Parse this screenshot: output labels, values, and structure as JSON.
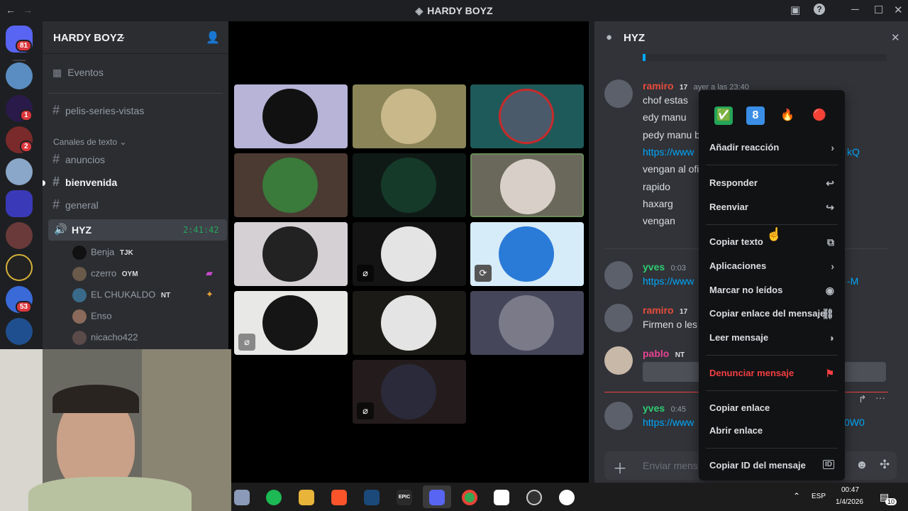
{
  "window": {
    "title": "HARDY BOYZ"
  },
  "rail": {
    "badges": [
      "81",
      "1",
      "2",
      "53"
    ]
  },
  "sidebar": {
    "server_name": "HARDY BOYZ",
    "events_label": "Eventos",
    "top_channel": "pelis-series-vistas",
    "category": "Canales de texto",
    "text_channels": [
      "anuncios",
      "bienvenida",
      "general"
    ],
    "voice_channel": "HYZ",
    "voice_timer": "2:41:42",
    "voice_users": [
      {
        "name": "Benja",
        "tag": "TJK"
      },
      {
        "name": "czerro",
        "tag": "OYM"
      },
      {
        "name": "EL CHUKALDO",
        "tag": "NT"
      },
      {
        "name": "Enso",
        "tag": ""
      },
      {
        "name": "nicacho422",
        "tag": ""
      }
    ]
  },
  "chat": {
    "channel": "HYZ",
    "messages": [
      {
        "user": "ramiro",
        "tag": "17",
        "time": "ayer a las 23:40",
        "lines": [
          "chof estas",
          "edy manu",
          "pedy manu b",
          "https://www",
          "vengan al ofi",
          "rapido",
          "haxarg",
          "vengan"
        ]
      },
      {
        "user": "yves",
        "time": "0:03",
        "lines": [
          "https://www"
        ]
      },
      {
        "user": "ramiro",
        "tag": "17",
        "lines": [
          "Firmen o les"
        ]
      },
      {
        "user": "pablo",
        "tag": "NT"
      },
      {
        "user": "yves",
        "time": "0:45",
        "lines": [
          "https://www"
        ]
      }
    ],
    "link_fragments": [
      "kQ",
      "-M",
      "0W0"
    ],
    "input_placeholder": "Enviar mens"
  },
  "context_menu": {
    "reactions": [
      "✅",
      "8",
      "🔥",
      "🔴"
    ],
    "items": [
      "Añadir reacción",
      "Responder",
      "Reenviar",
      "Copiar texto",
      "Aplicaciones",
      "Marcar no leídos",
      "Copiar enlace del mensaje",
      "Leer mensaje",
      "Denunciar mensaje",
      "Copiar enlace",
      "Abrir enlace",
      "Copiar ID del mensaje"
    ],
    "danger_color": "#f23f43"
  },
  "taskbar": {
    "lang": "ESP",
    "time": "00:47",
    "date": "1/4/2026",
    "notif_count": "10",
    "epic_label": "EPIC"
  }
}
